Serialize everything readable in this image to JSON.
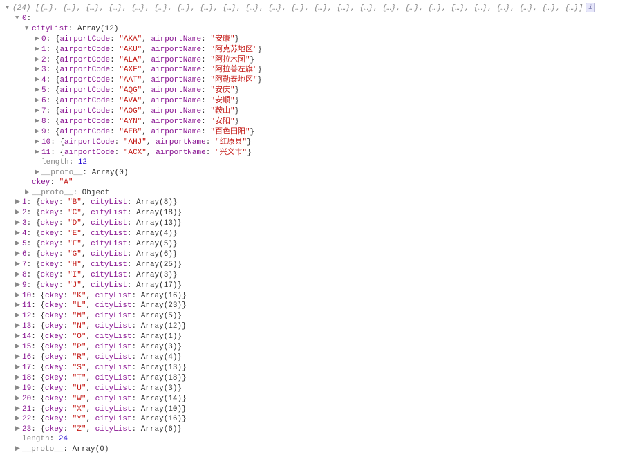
{
  "root": {
    "count": 24,
    "placeholders": 24
  },
  "cityList": {
    "label": "cityList",
    "arrayLabel": "Array",
    "count": 12,
    "lengthLabel": "length",
    "lengthValue": 12,
    "protoLabel": "__proto__",
    "protoValue": "Array(0)",
    "items": [
      {
        "idx": "0",
        "code": "AKA",
        "name": "安康"
      },
      {
        "idx": "1",
        "code": "AKU",
        "name": "阿克苏地区"
      },
      {
        "idx": "2",
        "code": "ALA",
        "name": "阿拉木图"
      },
      {
        "idx": "3",
        "code": "AXF",
        "name": "阿拉善左旗"
      },
      {
        "idx": "4",
        "code": "AAT",
        "name": "阿勒泰地区"
      },
      {
        "idx": "5",
        "code": "AQG",
        "name": "安庆"
      },
      {
        "idx": "6",
        "code": "AVA",
        "name": "安顺"
      },
      {
        "idx": "7",
        "code": "AOG",
        "name": "鞍山"
      },
      {
        "idx": "8",
        "code": "AYN",
        "name": "安阳"
      },
      {
        "idx": "9",
        "code": "AEB",
        "name": "百色田阳"
      },
      {
        "idx": "10",
        "code": "AHJ",
        "name": "红原县"
      },
      {
        "idx": "11",
        "code": "ACX",
        "name": "兴义市"
      }
    ],
    "codeKey": "airportCode",
    "nameKey": "airportName"
  },
  "ckey": {
    "label": "ckey",
    "value": "A"
  },
  "objProto": {
    "label": "__proto__",
    "value": "Object"
  },
  "groups": [
    {
      "idx": "1",
      "ckey": "B",
      "count": 8
    },
    {
      "idx": "2",
      "ckey": "C",
      "count": 18
    },
    {
      "idx": "3",
      "ckey": "D",
      "count": 13
    },
    {
      "idx": "4",
      "ckey": "E",
      "count": 4
    },
    {
      "idx": "5",
      "ckey": "F",
      "count": 5
    },
    {
      "idx": "6",
      "ckey": "G",
      "count": 6
    },
    {
      "idx": "7",
      "ckey": "H",
      "count": 25
    },
    {
      "idx": "8",
      "ckey": "I",
      "count": 3
    },
    {
      "idx": "9",
      "ckey": "J",
      "count": 17
    },
    {
      "idx": "10",
      "ckey": "K",
      "count": 16
    },
    {
      "idx": "11",
      "ckey": "L",
      "count": 23
    },
    {
      "idx": "12",
      "ckey": "M",
      "count": 5
    },
    {
      "idx": "13",
      "ckey": "N",
      "count": 12
    },
    {
      "idx": "14",
      "ckey": "O",
      "count": 1
    },
    {
      "idx": "15",
      "ckey": "P",
      "count": 3
    },
    {
      "idx": "16",
      "ckey": "R",
      "count": 4
    },
    {
      "idx": "17",
      "ckey": "S",
      "count": 13
    },
    {
      "idx": "18",
      "ckey": "T",
      "count": 18
    },
    {
      "idx": "19",
      "ckey": "U",
      "count": 3
    },
    {
      "idx": "20",
      "ckey": "W",
      "count": 14
    },
    {
      "idx": "21",
      "ckey": "X",
      "count": 10
    },
    {
      "idx": "22",
      "ckey": "Y",
      "count": 16
    },
    {
      "idx": "23",
      "ckey": "Z",
      "count": 6
    }
  ],
  "groupFields": {
    "ckeyLabel": "ckey",
    "cityListLabel": "cityList",
    "arrayLabel": "Array"
  },
  "footer": {
    "lengthLabel": "length",
    "lengthValue": 24,
    "protoLabel": "__proto__",
    "protoValue": "Array(0)"
  }
}
